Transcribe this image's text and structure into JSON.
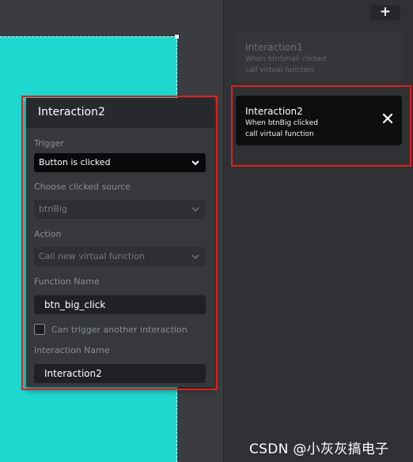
{
  "side_panel": {
    "add_label": "+",
    "interactions": [
      {
        "title": "Interaction1",
        "line1": "When btnSmall clicked",
        "line2": "call virtual function"
      },
      {
        "title": "Interaction2",
        "line1": "When btnBig clicked",
        "line2": "call virtual function"
      }
    ]
  },
  "editor": {
    "title": "Interaction2",
    "trigger_label": "Trigger",
    "trigger_value": "Button is clicked",
    "source_label": "Choose clicked source",
    "source_value": "btnBig",
    "action_label": "Action",
    "action_value": "Call new virtual function",
    "function_name_label": "Function Name",
    "function_name_value": "btn_big_click",
    "chain_label": "Can trigger another interaction",
    "interaction_name_label": "Interaction Name",
    "interaction_name_value": "Interaction2"
  },
  "watermark": "CSDN @小灰灰搞电子",
  "colors": {
    "canvas_widget": "#1ed8d0",
    "highlight": "#e0201c",
    "panel": "#2f3135"
  },
  "icons": {
    "add": "plus-icon",
    "close": "close-icon",
    "dropdown": "chevron-down-icon"
  }
}
